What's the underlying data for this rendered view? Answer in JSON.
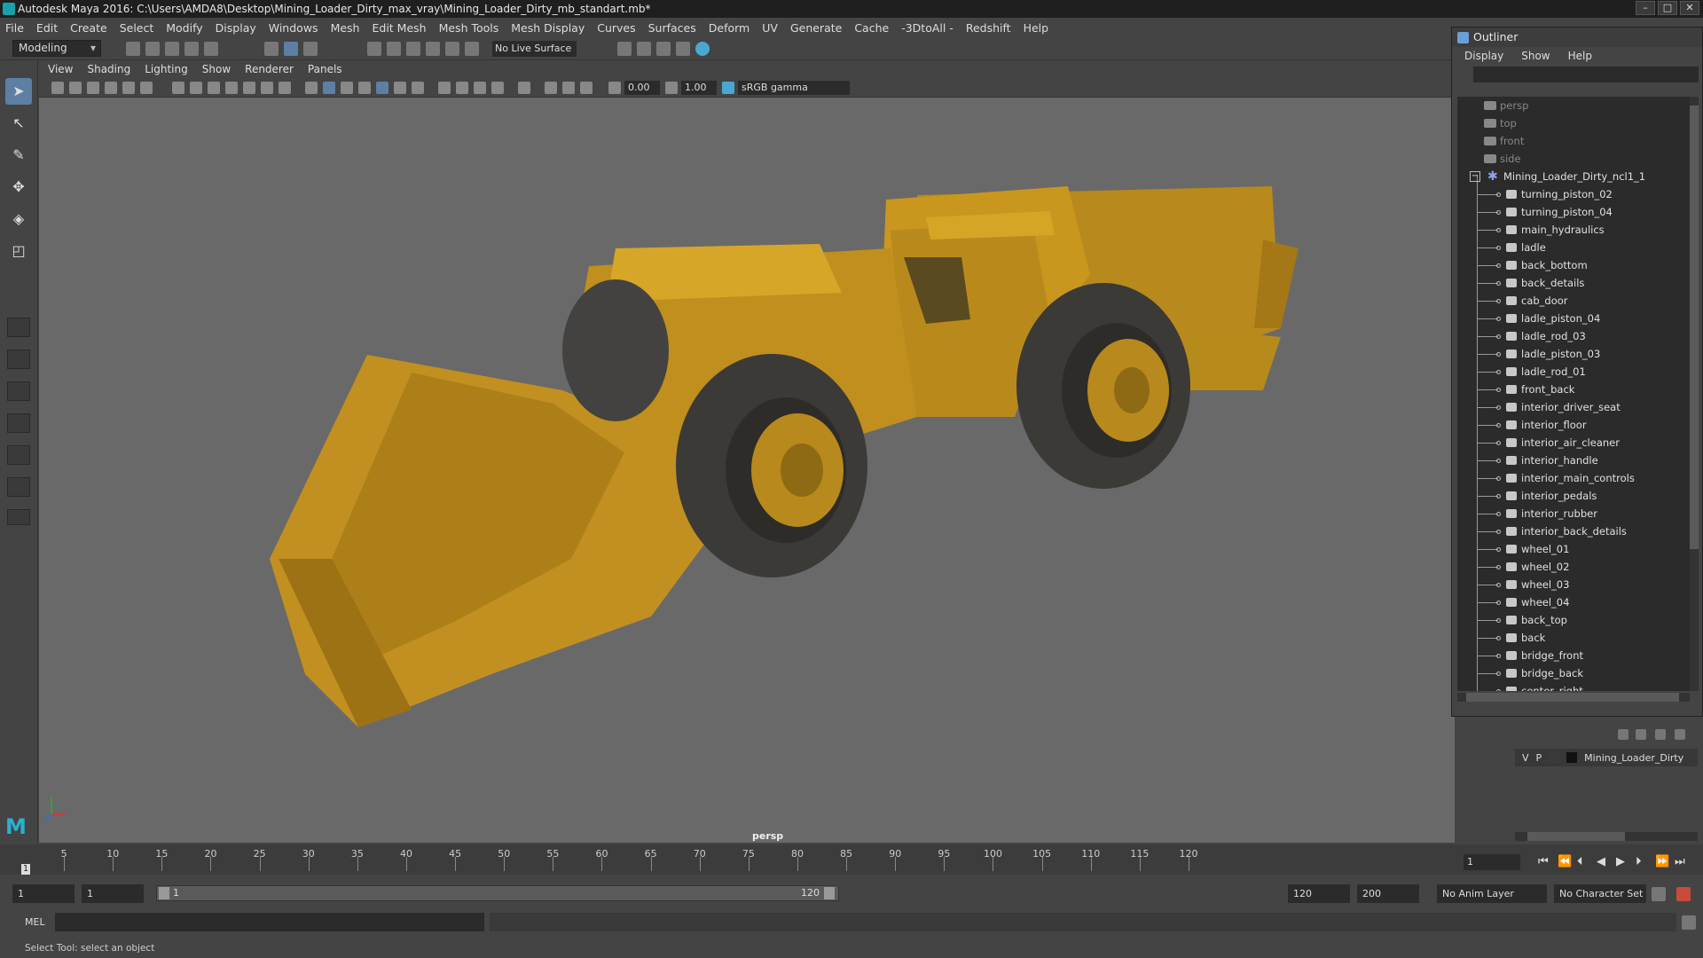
{
  "window": {
    "title": "Autodesk Maya 2016: C:\\Users\\AMDA8\\Desktop\\Mining_Loader_Dirty_max_vray\\Mining_Loader_Dirty_mb_standart.mb*"
  },
  "menu": [
    "File",
    "Edit",
    "Create",
    "Select",
    "Modify",
    "Display",
    "Windows",
    "Mesh",
    "Edit Mesh",
    "Mesh Tools",
    "Mesh Display",
    "Curves",
    "Surfaces",
    "Deform",
    "UV",
    "Generate",
    "Cache",
    "-3DtoAll -",
    "Redshift",
    "Help"
  ],
  "statusline": {
    "mode": "Modeling",
    "live_surface": "No Live Surface"
  },
  "viewport": {
    "menu": [
      "View",
      "Shading",
      "Lighting",
      "Show",
      "Renderer",
      "Panels"
    ],
    "exposure": "0.00",
    "gamma": "1.00",
    "colorspace": "sRGB gamma",
    "camera_label": "persp"
  },
  "outliner": {
    "title": "Outliner",
    "menu": [
      "Display",
      "Show",
      "Help"
    ],
    "cameras": [
      "persp",
      "top",
      "front",
      "side"
    ],
    "root": "Mining_Loader_Dirty_ncl1_1",
    "children": [
      "turning_piston_02",
      "turning_piston_04",
      "main_hydraulics",
      "ladle",
      "back_bottom",
      "back_details",
      "cab_door",
      "ladle_piston_04",
      "ladle_rod_03",
      "ladle_piston_03",
      "ladle_rod_01",
      "front_back",
      "interior_driver_seat",
      "interior_floor",
      "interior_air_cleaner",
      "interior_handle",
      "interior_main_controls",
      "interior_pedals",
      "interior_rubber",
      "interior_back_details",
      "wheel_01",
      "wheel_02",
      "wheel_03",
      "wheel_04",
      "back_top",
      "back",
      "bridge_front",
      "bridge_back",
      "center_right"
    ]
  },
  "layers": {
    "v": "V",
    "p": "P",
    "name": "Mining_Loader_Dirty"
  },
  "timeline": {
    "ticks": [
      "5",
      "10",
      "15",
      "20",
      "25",
      "30",
      "35",
      "40",
      "45",
      "50",
      "55",
      "60",
      "65",
      "70",
      "75",
      "80",
      "85",
      "90",
      "95",
      "100",
      "105",
      "110",
      "115",
      "120"
    ],
    "current": "1",
    "current_field": "1"
  },
  "range": {
    "start": "1",
    "playback_start": "1",
    "slider_start": "1",
    "slider_end": "120",
    "playback_end": "120",
    "end": "200",
    "anim_layer": "No Anim Layer",
    "character_set": "No Character Set"
  },
  "mel": {
    "label": "MEL"
  },
  "help": {
    "text": "Select Tool: select an object"
  },
  "colors": {
    "machine_yellow": "#c9961e",
    "tire": "#3a3a3a",
    "viewport_bg": "#696969",
    "active_tool": "#5d7fa3"
  }
}
